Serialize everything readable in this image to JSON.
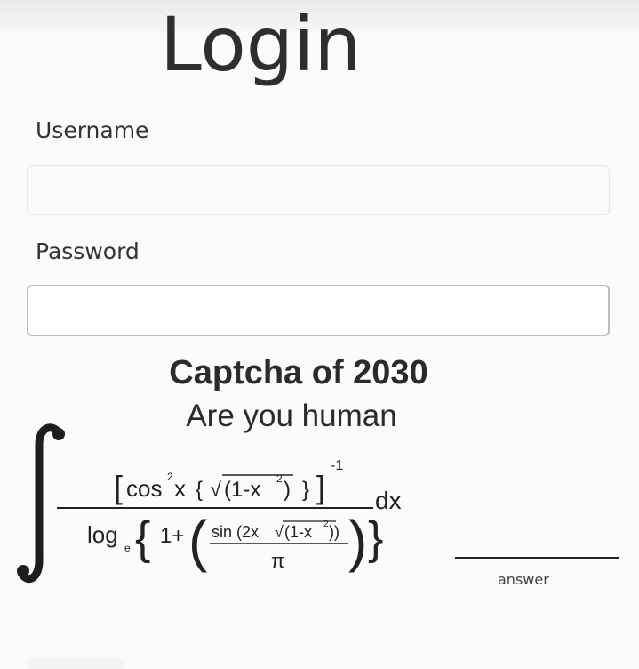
{
  "login": {
    "title": "Login",
    "username_label": "Username",
    "username_value": "",
    "password_label": "Password",
    "password_value": ""
  },
  "captcha": {
    "title": "Captcha of 2030",
    "subtitle": "Are you human",
    "numerator": {
      "left_bracket": "[",
      "cos": "cos",
      "cos_power": "2",
      "x": "x",
      "open_brace": "{",
      "radical": "√",
      "radicand": "(1-x",
      "radicand_power": "2",
      "radicand_close": ")",
      "close_brace": "}",
      "right_bracket": "]",
      "outer_power": "-1"
    },
    "denominator": {
      "log": "log",
      "log_base": "e",
      "open_brace": "{",
      "one_plus": "1+",
      "open_paren": "(",
      "sin_text": "sin (2x",
      "inner_radical": "√",
      "inner_radicand": "(1-x",
      "inner_power": "2",
      "inner_close": "))",
      "pi": "π",
      "close_paren": ")",
      "close_brace": "}"
    },
    "differential": "dx",
    "answer_label": "answer"
  }
}
